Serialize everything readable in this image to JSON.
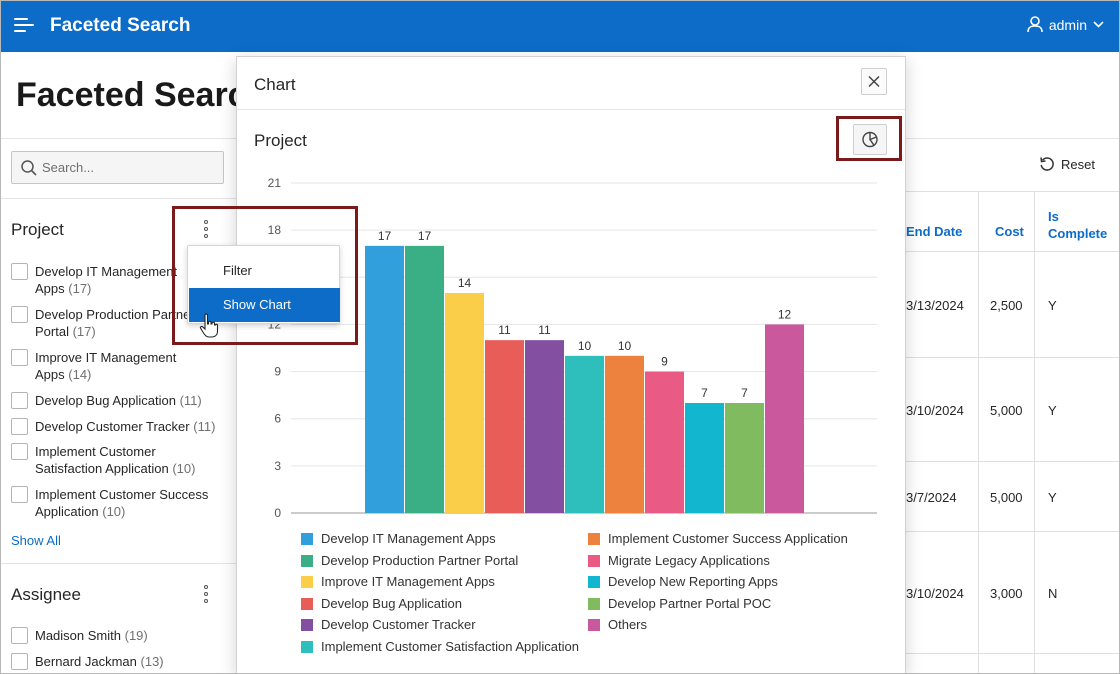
{
  "header": {
    "app_title": "Faceted Search",
    "user": "admin"
  },
  "page": {
    "title": "Faceted Search"
  },
  "search": {
    "placeholder": "Search..."
  },
  "facets": {
    "project": {
      "title": "Project",
      "items": [
        {
          "line1": "Develop IT Management",
          "line2": "Apps",
          "count": "(17)"
        },
        {
          "line1": "Develop Production Partner",
          "line2": "Portal",
          "count": "(17)"
        },
        {
          "line1": "Improve IT Management",
          "line2": "Apps",
          "count": "(14)"
        },
        {
          "line1": "Develop Bug Application",
          "line2": "",
          "count": "(11)"
        },
        {
          "line1": "Develop Customer Tracker",
          "line2": "",
          "count": "(11)"
        },
        {
          "line1": "Implement Customer",
          "line2": "Satisfaction Application",
          "count": "(10)"
        },
        {
          "line1": "Implement Customer Success",
          "line2": "Application",
          "count": "(10)"
        }
      ],
      "show_all": "Show All"
    },
    "assignee": {
      "title": "Assignee",
      "items": [
        {
          "label": "Madison Smith",
          "count": "(19)"
        },
        {
          "label": "Bernard Jackman",
          "count": "(13)"
        }
      ]
    }
  },
  "menu": {
    "items": [
      "Filter",
      "Show Chart"
    ],
    "active_index": 1
  },
  "toolbar": {
    "reset": "Reset"
  },
  "table": {
    "headers": {
      "end_date": "End Date",
      "cost": "Cost",
      "is_complete_1": "Is",
      "is_complete_2": "Complete"
    },
    "rows": [
      {
        "end_date": "3/13/2024",
        "cost": "2,500",
        "is_complete": "Y"
      },
      {
        "end_date": "3/10/2024",
        "cost": "5,000",
        "is_complete": "Y"
      },
      {
        "end_date": "3/7/2024",
        "cost": "5,000",
        "is_complete": "Y"
      },
      {
        "end_date": "3/10/2024",
        "cost": "3,000",
        "is_complete": "N"
      }
    ]
  },
  "dialog": {
    "title": "Chart",
    "chart_title": "Project"
  },
  "colors": {
    "brand": "#0c6cc8",
    "highlight": "#7a1a1a"
  },
  "chart_data": {
    "type": "bar",
    "title": "Project",
    "xlabel": "",
    "ylabel": "",
    "ylim": [
      0,
      21
    ],
    "yticks": [
      0,
      3,
      6,
      9,
      12,
      15,
      18,
      21
    ],
    "grid": true,
    "legend_position": "bottom",
    "categories": [
      "Develop IT Management Apps",
      "Develop Production Partner Portal",
      "Improve IT Management Apps",
      "Develop Bug Application",
      "Develop Customer Tracker",
      "Implement Customer Satisfaction Application",
      "Implement Customer Success Application",
      "Migrate Legacy Applications",
      "Develop New Reporting Apps",
      "Develop Partner Portal POC",
      "Others"
    ],
    "values": [
      17,
      17,
      14,
      11,
      11,
      10,
      10,
      9,
      7,
      7,
      12
    ],
    "colors": [
      "#309fdb",
      "#3aaf85",
      "#fbce4a",
      "#e85d58",
      "#8350a1",
      "#2ebfbc",
      "#ed813e",
      "#e95b84",
      "#13b6cf",
      "#81bb5f",
      "#ca589d"
    ]
  }
}
